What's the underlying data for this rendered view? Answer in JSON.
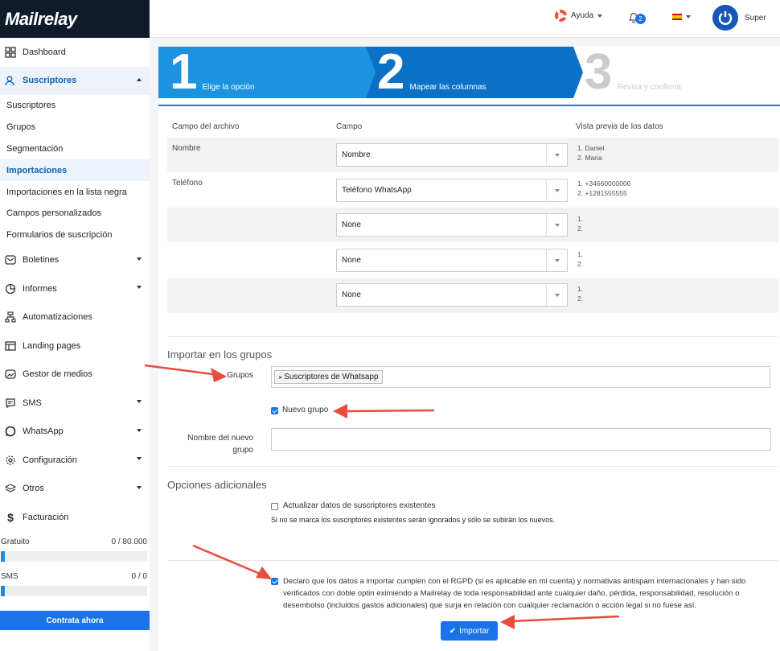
{
  "app": {
    "logo_text": "Mailrelay"
  },
  "sidebar": {
    "items": [
      {
        "label": "Dashboard",
        "icon": "dashboard-icon"
      },
      {
        "label": "Suscriptores",
        "icon": "users-icon",
        "active": true
      },
      {
        "label": "Boletines",
        "icon": "mail-icon"
      },
      {
        "label": "Informes",
        "icon": "pie-chart-icon"
      },
      {
        "label": "Automatizaciones",
        "icon": "automation-icon"
      },
      {
        "label": "Landing pages",
        "icon": "landing-icon"
      },
      {
        "label": "Gestor de medios",
        "icon": "media-icon"
      },
      {
        "label": "SMS",
        "icon": "sms-icon"
      },
      {
        "label": "WhatsApp",
        "icon": "whatsapp-icon"
      },
      {
        "label": "Configuración",
        "icon": "gear-icon"
      },
      {
        "label": "Otros",
        "icon": "layers-icon"
      },
      {
        "label": "Facturación",
        "icon": "dollar-icon"
      }
    ],
    "subitems": [
      "Suscriptores",
      "Grupos",
      "Segmentación",
      "Importaciones",
      "Importaciones en la lista negra",
      "Campos personalizados",
      "Formularios de suscripción"
    ],
    "usage": [
      {
        "label": "Gratuito",
        "value": "0 / 80.000",
        "fill_fraction": 0.0
      },
      {
        "label": "SMS",
        "value": "0 / 0",
        "fill_fraction": 0.0
      }
    ],
    "contract_label": "Contrata ahora"
  },
  "topbar": {
    "help_label": "Ayuda",
    "notification_count": "2",
    "user_name": "Super"
  },
  "steps": [
    {
      "num": "1",
      "label": "Elige la opción"
    },
    {
      "num": "2",
      "label": "Mapear las columnas"
    },
    {
      "num": "3",
      "label": "Revisa y confirma"
    }
  ],
  "mapping": {
    "headers": [
      "Campo del archivo",
      "Campo",
      "Vista previa de los datos"
    ],
    "rows": [
      {
        "file_field": "Nombre",
        "field": "Nombre",
        "preview": [
          "1. Daniel",
          "2. Maria"
        ]
      },
      {
        "file_field": "Teléfono",
        "field": "Teléfono WhatsApp",
        "preview": [
          "1. +34660000000",
          "2. +1281555555"
        ]
      },
      {
        "file_field": "",
        "field": "None",
        "preview": [
          "1.",
          "2."
        ]
      },
      {
        "file_field": "",
        "field": "None",
        "preview": [
          "1.",
          "2."
        ]
      },
      {
        "file_field": "",
        "field": "None",
        "preview": [
          "1.",
          "2."
        ]
      }
    ]
  },
  "groups": {
    "section_title": "Importar en los grupos",
    "groups_label": "Grupos",
    "tag_label": "Suscriptores de Whatsapp",
    "new_group_label": "Nuevo grupo",
    "new_group_name_label": "Nombre del nuevo grupo",
    "new_group_line1": "Nombre del nuevo",
    "new_group_line2": "grupo"
  },
  "options": {
    "section_title": "Opciones adicionales",
    "update_label": "Actualizar datos de suscriptores existentes",
    "update_note": "Si no se marca los suscriptores existentes serán ignorados y sólo se subirán los nuevos.",
    "gdpr_text": "Declaro que los datos a importar cumplen con el RGPD (si es aplicable en mi cuenta) y normativas antispam internacionales y han sido verificados con doble optin eximiendo a Mailrelay de toda responsabilidad ante cualquier daño, pérdida, responsabilidad, resolución o desembolso (incluidos gastos adicionales) que surja en relación con cualquier reclamación o acción legal si no fuese así.",
    "import_label": "Importar"
  },
  "colors": {
    "accent": "#1a73e8",
    "step1": "#1d93df",
    "step2": "#0b71c6",
    "annotation": "#e74c3c"
  }
}
